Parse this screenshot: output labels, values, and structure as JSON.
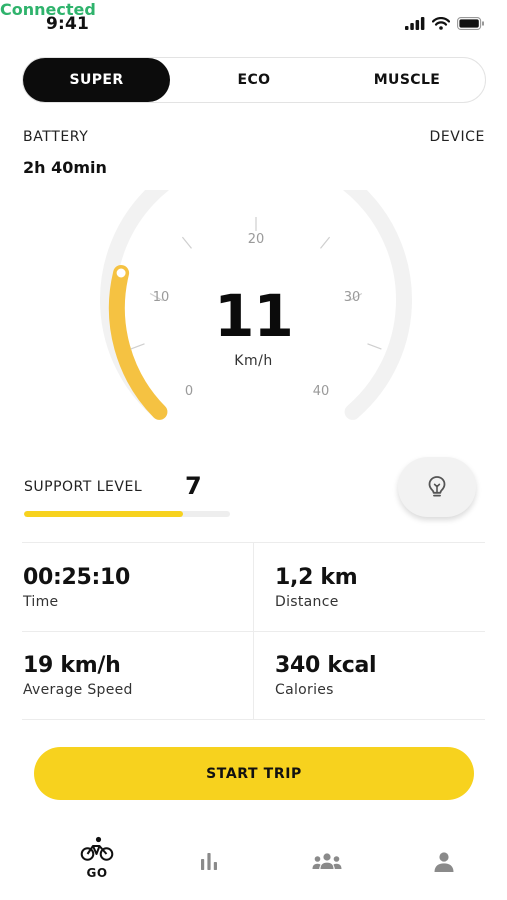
{
  "status_bar": {
    "time": "9:41"
  },
  "modes": {
    "items": [
      "SUPER",
      "ECO",
      "MUSCLE"
    ],
    "selected": "SUPER"
  },
  "battery": {
    "label": "BATTERY",
    "value": "2h 40min"
  },
  "device": {
    "label": "DEVICE",
    "value": "Connected",
    "status_color": "#2fb36c"
  },
  "speedometer": {
    "speed": "11",
    "unit": "Km/h",
    "ticks": [
      "0",
      "10",
      "20",
      "30",
      "40"
    ],
    "min": 0,
    "max": 40,
    "current": 11,
    "active_color": "#f5c242",
    "track_color": "#f2f2f2"
  },
  "support": {
    "label": "SUPPORT LEVEL",
    "value": "7",
    "level_fraction": 0.77,
    "accent": "#f7d21e"
  },
  "stats": {
    "time": {
      "value": "00:25:10",
      "label": "Time"
    },
    "distance": {
      "value": "1,2 km",
      "label": "Distance"
    },
    "average_speed": {
      "value": "19 km/h",
      "label": "Average Speed"
    },
    "calories": {
      "value": "340 kcal",
      "label": "Calories"
    }
  },
  "actions": {
    "start_trip": "START TRIP"
  },
  "tabs": {
    "go": {
      "label": "GO",
      "icon": "bicycle-icon"
    },
    "stats": {
      "icon": "bar-chart-icon"
    },
    "community": {
      "icon": "group-icon"
    },
    "profile": {
      "icon": "user-icon"
    }
  }
}
